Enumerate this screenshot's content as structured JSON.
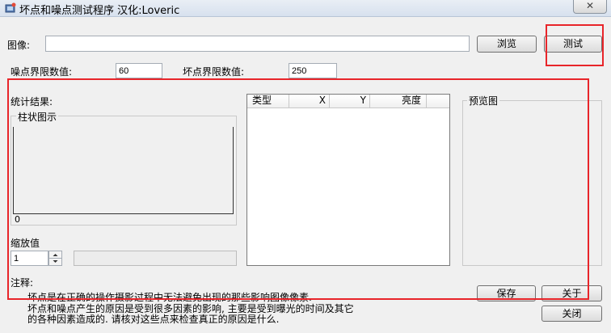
{
  "window": {
    "title": "坏点和噪点测试程序  汉化:Loveric",
    "close_glyph": "✕"
  },
  "image_row": {
    "label": "图像:",
    "path_value": "",
    "browse_label": "浏览",
    "test_label": "测试"
  },
  "thresholds": {
    "noise_label": "噪点界限数值:",
    "noise_value": "60",
    "dead_label": "坏点界限数值:",
    "dead_value": "250"
  },
  "stats": {
    "label": "统计结果:",
    "histogram": {
      "legend": "柱状图示",
      "axis_zero": "0"
    },
    "zoom": {
      "label": "缩放值",
      "value": "1"
    }
  },
  "table": {
    "columns": [
      "类型",
      "X",
      "Y",
      "亮度"
    ],
    "rows": []
  },
  "preview": {
    "legend": "预览图"
  },
  "notes": {
    "label": "注释:",
    "line1": "坏点是在正确的操作摄影过程中无法避免出现的那些影响图像像素.",
    "line2": "坏点和噪点产生的原因是受到很多因素的影响, 主要是受到曝光的时间及其它",
    "line3": "的各种因素造成的. 请核对这些点来检查真正的原因是什么."
  },
  "buttons": {
    "save": "保存",
    "about": "关于",
    "close": "关闭"
  }
}
